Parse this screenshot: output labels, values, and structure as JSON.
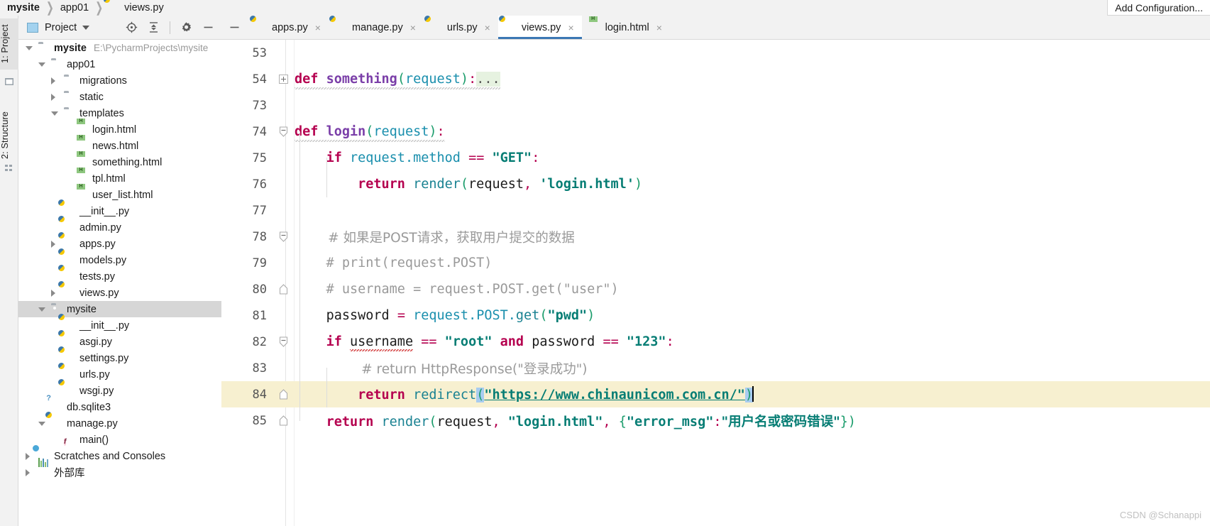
{
  "window": {
    "breadcrumb": [
      "mysite",
      "app01",
      "views.py"
    ],
    "add_configuration_label": "Add Configuration..."
  },
  "left_strip": {
    "tabs": [
      {
        "label": "1: Project",
        "icon": "project-icon"
      },
      {
        "label": "2: Structure",
        "icon": "structure-icon"
      }
    ]
  },
  "project_panel": {
    "title": "Project",
    "toolbar": [
      {
        "name": "locate-icon",
        "tooltip": "Select Opened File"
      },
      {
        "name": "collapse-all-icon",
        "tooltip": "Collapse All"
      },
      {
        "name": "gear-icon",
        "tooltip": "Settings"
      },
      {
        "name": "hide-icon",
        "tooltip": "Hide"
      }
    ]
  },
  "tree": [
    {
      "label": "mysite",
      "path": "E:\\PycharmProjects\\mysite",
      "icon": "folder-icon",
      "indent": 0,
      "arrow": "open",
      "bold": true,
      "selected": false
    },
    {
      "label": "app01",
      "path": "",
      "icon": "folder-source-icon",
      "indent": 1,
      "arrow": "open",
      "bold": false,
      "selected": false
    },
    {
      "label": "migrations",
      "path": "",
      "icon": "folder-source-icon",
      "indent": 2,
      "arrow": "closed",
      "bold": false,
      "selected": false
    },
    {
      "label": "static",
      "path": "",
      "icon": "folder-icon",
      "indent": 2,
      "arrow": "closed",
      "bold": false,
      "selected": false
    },
    {
      "label": "templates",
      "path": "",
      "icon": "folder-icon",
      "indent": 2,
      "arrow": "open",
      "bold": false,
      "selected": false
    },
    {
      "label": "login.html",
      "path": "",
      "icon": "html-file-icon",
      "indent": 3,
      "arrow": "",
      "bold": false,
      "selected": false
    },
    {
      "label": "news.html",
      "path": "",
      "icon": "html-file-icon",
      "indent": 3,
      "arrow": "",
      "bold": false,
      "selected": false
    },
    {
      "label": "something.html",
      "path": "",
      "icon": "html-file-icon",
      "indent": 3,
      "arrow": "",
      "bold": false,
      "selected": false
    },
    {
      "label": "tpl.html",
      "path": "",
      "icon": "html-file-icon",
      "indent": 3,
      "arrow": "",
      "bold": false,
      "selected": false
    },
    {
      "label": "user_list.html",
      "path": "",
      "icon": "html-file-icon",
      "indent": 3,
      "arrow": "",
      "bold": false,
      "selected": false
    },
    {
      "label": "__init__.py",
      "path": "",
      "icon": "python-file-icon",
      "indent": 2,
      "arrow": "",
      "bold": false,
      "selected": false
    },
    {
      "label": "admin.py",
      "path": "",
      "icon": "python-file-icon",
      "indent": 2,
      "arrow": "",
      "bold": false,
      "selected": false
    },
    {
      "label": "apps.py",
      "path": "",
      "icon": "python-file-icon",
      "indent": 2,
      "arrow": "closed",
      "bold": false,
      "selected": false
    },
    {
      "label": "models.py",
      "path": "",
      "icon": "python-file-icon",
      "indent": 2,
      "arrow": "",
      "bold": false,
      "selected": false
    },
    {
      "label": "tests.py",
      "path": "",
      "icon": "python-file-icon",
      "indent": 2,
      "arrow": "",
      "bold": false,
      "selected": false
    },
    {
      "label": "views.py",
      "path": "",
      "icon": "python-file-icon",
      "indent": 2,
      "arrow": "closed",
      "bold": false,
      "selected": false
    },
    {
      "label": "mysite",
      "path": "",
      "icon": "folder-source-icon",
      "indent": 1,
      "arrow": "open",
      "bold": false,
      "selected": true
    },
    {
      "label": "__init__.py",
      "path": "",
      "icon": "python-file-icon",
      "indent": 2,
      "arrow": "",
      "bold": false,
      "selected": false
    },
    {
      "label": "asgi.py",
      "path": "",
      "icon": "python-file-icon",
      "indent": 2,
      "arrow": "",
      "bold": false,
      "selected": false
    },
    {
      "label": "settings.py",
      "path": "",
      "icon": "python-file-icon",
      "indent": 2,
      "arrow": "",
      "bold": false,
      "selected": false
    },
    {
      "label": "urls.py",
      "path": "",
      "icon": "python-file-icon",
      "indent": 2,
      "arrow": "",
      "bold": false,
      "selected": false
    },
    {
      "label": "wsgi.py",
      "path": "",
      "icon": "python-file-icon",
      "indent": 2,
      "arrow": "",
      "bold": false,
      "selected": false
    },
    {
      "label": "db.sqlite3",
      "path": "",
      "icon": "db-file-icon",
      "indent": 1,
      "arrow": "",
      "bold": false,
      "selected": false
    },
    {
      "label": "manage.py",
      "path": "",
      "icon": "python-file-icon",
      "indent": 1,
      "arrow": "open",
      "bold": false,
      "selected": false
    },
    {
      "label": "main()",
      "path": "",
      "icon": "function-icon",
      "indent": 2,
      "arrow": "",
      "bold": false,
      "selected": false
    },
    {
      "label": "Scratches and Consoles",
      "path": "",
      "icon": "scratches-icon",
      "indent": 0,
      "arrow": "closed",
      "bold": false,
      "selected": false
    },
    {
      "label": "外部库",
      "path": "",
      "icon": "external-libraries-icon",
      "indent": 0,
      "arrow": "closed",
      "bold": false,
      "selected": false
    }
  ],
  "editor_tabs": [
    {
      "label": "apps.py",
      "icon": "python-file-icon",
      "active": false
    },
    {
      "label": "manage.py",
      "icon": "python-file-icon",
      "active": false
    },
    {
      "label": "urls.py",
      "icon": "python-file-icon",
      "active": false
    },
    {
      "label": "views.py",
      "icon": "python-file-icon",
      "active": true
    },
    {
      "label": "login.html",
      "icon": "html-file-icon",
      "active": false
    }
  ],
  "editor": {
    "active_file": "views.py",
    "current_line": 84,
    "lines": [
      {
        "num": "53",
        "text": ""
      },
      {
        "num": "54",
        "text": "def something(request):..."
      },
      {
        "num": "73",
        "text": ""
      },
      {
        "num": "74",
        "text": "def login(request):"
      },
      {
        "num": "75",
        "text": "    if request.method == \"GET\":"
      },
      {
        "num": "76",
        "text": "        return render(request, 'login.html')"
      },
      {
        "num": "77",
        "text": ""
      },
      {
        "num": "78",
        "text": "    # 如果是POST请求，获取用户提交的数据"
      },
      {
        "num": "79",
        "text": "    # print(request.POST)"
      },
      {
        "num": "80",
        "text": "    # username = request.POST.get(\"user\")"
      },
      {
        "num": "81",
        "text": "    password = request.POST.get(\"pwd\")"
      },
      {
        "num": "82",
        "text": "    if username == \"root\" and password == \"123\":"
      },
      {
        "num": "83",
        "text": "        # return HttpResponse(\"登录成功\")"
      },
      {
        "num": "84",
        "text": "        return redirect(\"https://www.chinaunicom.com.cn/\")"
      },
      {
        "num": "85",
        "text": "    return render(request, \"login.html\", {\"error_msg\":\"用户名或密码错误\"})"
      }
    ],
    "tokens": {
      "kw_def": "def",
      "kw_if": "if",
      "kw_and": "and",
      "kw_return": "return",
      "fn_something": "something",
      "fn_login": "login",
      "fn_render": "render",
      "fn_redirect": "redirect",
      "fn_get": "get",
      "var_request": "request",
      "var_password": "password",
      "var_username": "username",
      "attr_method": "method",
      "attr_POST": "POST",
      "str_GET": "\"GET\"",
      "str_login_html_single": "'login.html'",
      "str_login_html": "\"login.html\"",
      "str_pwd": "\"pwd\"",
      "str_root": "\"root\"",
      "str_123": "\"123\"",
      "str_url": "\"https://www.chinaunicom.com.cn/\"",
      "str_error_msg": "\"error_msg\"",
      "str_error_value": "\"用户名或密码错误\"",
      "cmt_post": "# 如果是POST请求，获取用户提交的数据",
      "cmt_print": "# print(request.POST)",
      "cmt_username": "# username = request.POST.get(\"user\")",
      "cmt_httpresponse": "# return HttpResponse(\"登录成功\")",
      "folded_dots": "..."
    }
  },
  "watermark": "CSDN @Schanappi",
  "colors": {
    "keyword": "#b5004f",
    "function": "#7a3ea8",
    "string": "#067d74",
    "comment": "#9a9a9a",
    "attribute": "#1a8fad",
    "paren": "#1a9c6b",
    "current_line_bg": "#f7f0d0",
    "selection_bg": "#a8ccf0",
    "tab_underline": "#3c78b4",
    "tree_selection_bg": "#d6d6d6"
  }
}
